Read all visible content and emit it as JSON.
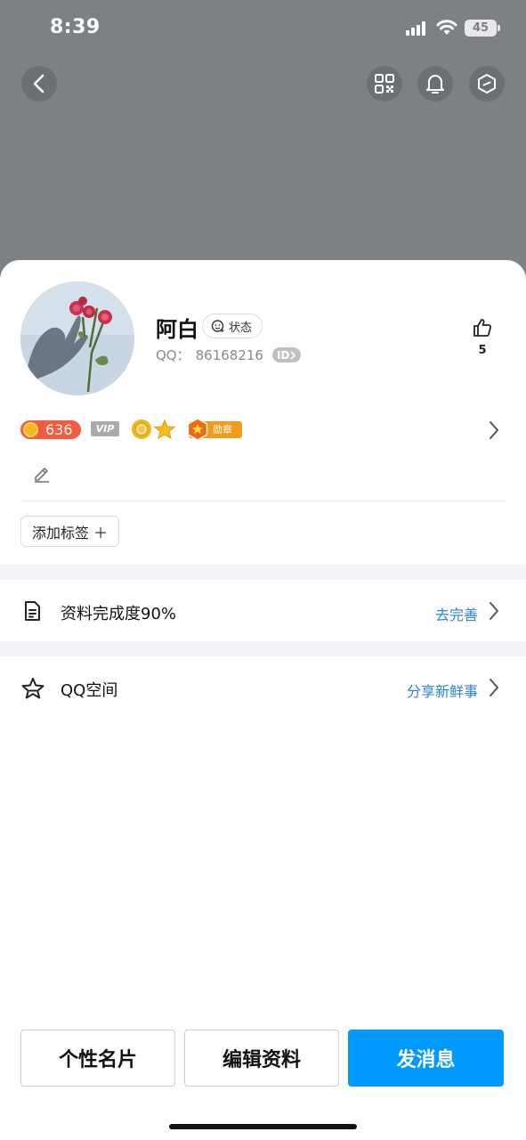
{
  "status_bar": {
    "time": "8:39",
    "battery": "45"
  },
  "profile": {
    "nickname": "阿白",
    "status_label": "状态",
    "qq_label": "QQ：",
    "qq_number": "86168216",
    "id_badge": "ID",
    "likes": "5"
  },
  "badges": {
    "level": "636",
    "vip": "VIP",
    "medal": "勋章"
  },
  "tags": {
    "add_label": "添加标签 ＋"
  },
  "rows": [
    {
      "label": "资料完成度90%",
      "action": "去完善",
      "icon": "document-icon"
    },
    {
      "label": "QQ空间",
      "action": "分享新鲜事",
      "icon": "star-outline-icon"
    }
  ],
  "buttons": {
    "card": "个性名片",
    "edit": "编辑资料",
    "message": "发消息"
  },
  "colors": {
    "header_bg": "#7d8085",
    "accent_blue": "#0099ff",
    "link_blue": "#2c82d9",
    "level_red": "#f25b3d",
    "medal_orange": "#f49a1a"
  }
}
